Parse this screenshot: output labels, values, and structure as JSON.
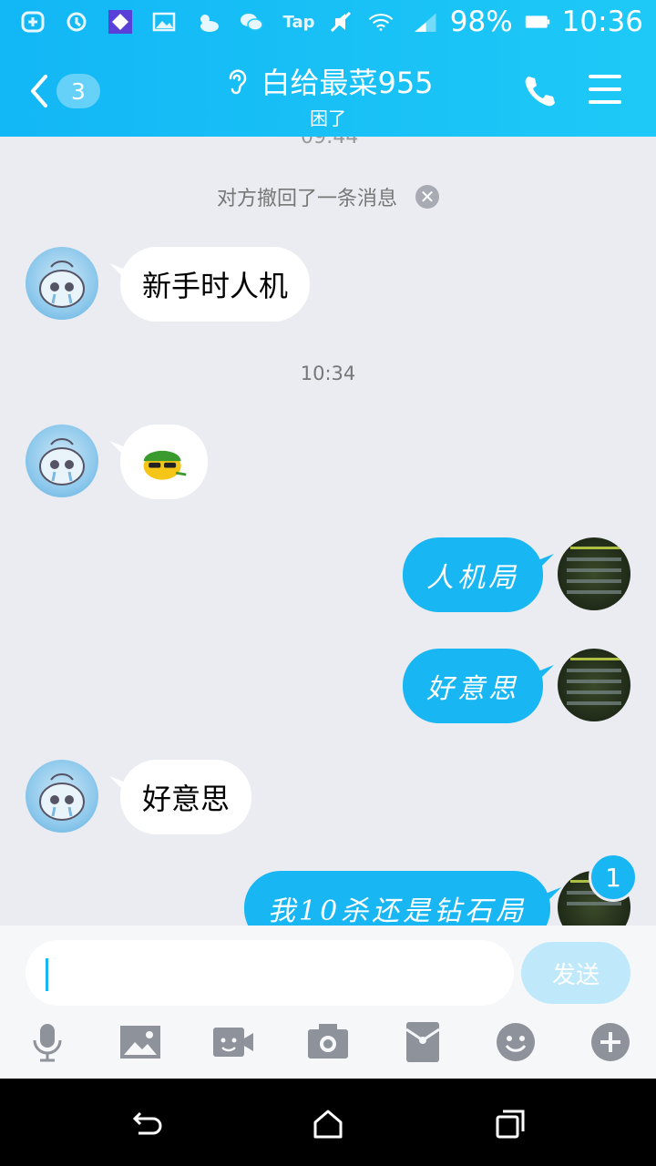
{
  "status_bar": {
    "battery": "98%",
    "time": "10:36",
    "tap_label": "Tap"
  },
  "header": {
    "back_count": "3",
    "title": "白给最菜955",
    "status": "困了"
  },
  "messages": {
    "cut_time": "09:44",
    "recall_notice": "对方撤回了一条消息",
    "timestamp": "10:34",
    "items": [
      {
        "side": "left",
        "text": "新手时人机"
      },
      {
        "side": "left",
        "text": ""
      },
      {
        "side": "right",
        "text": "人机局"
      },
      {
        "side": "right",
        "text": "好意思"
      },
      {
        "side": "left",
        "text": "好意思"
      },
      {
        "side": "right",
        "text": "我10杀还是钻石局"
      }
    ],
    "unread": "1"
  },
  "input": {
    "placeholder": "",
    "send_label": "发送"
  },
  "icons": {
    "toolbar": [
      "microphone-icon",
      "image-icon",
      "video-icon",
      "camera-icon",
      "red-packet-icon",
      "emoji-icon",
      "plus-icon"
    ]
  },
  "colors": {
    "brand": "#12b7f5",
    "bubble_right": "#18b6f2",
    "background": "#eaecf1"
  }
}
